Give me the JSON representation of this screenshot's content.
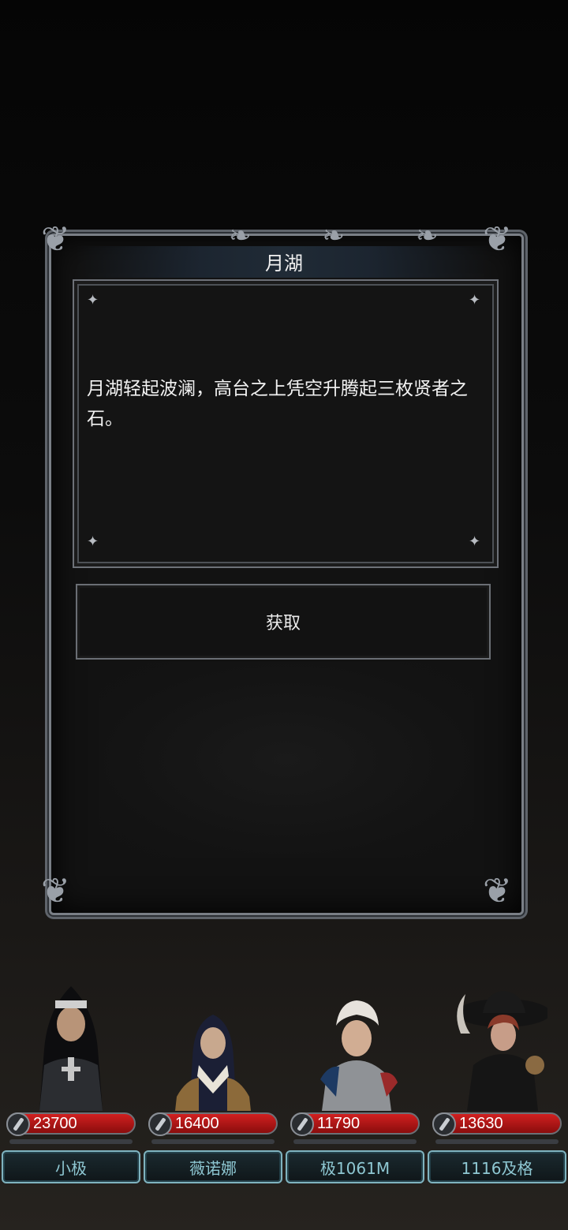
{
  "dialog": {
    "title": "月湖",
    "text": "月湖轻起波澜，高台之上凭空升腾起三枚贤者之石。",
    "action_label": "获取"
  },
  "party": [
    {
      "hp": "23700",
      "name": "小极"
    },
    {
      "hp": "16400",
      "name": "薇诺娜"
    },
    {
      "hp": "11790",
      "name": "极1061M"
    },
    {
      "hp": "13630",
      "name": "1116及格"
    }
  ]
}
